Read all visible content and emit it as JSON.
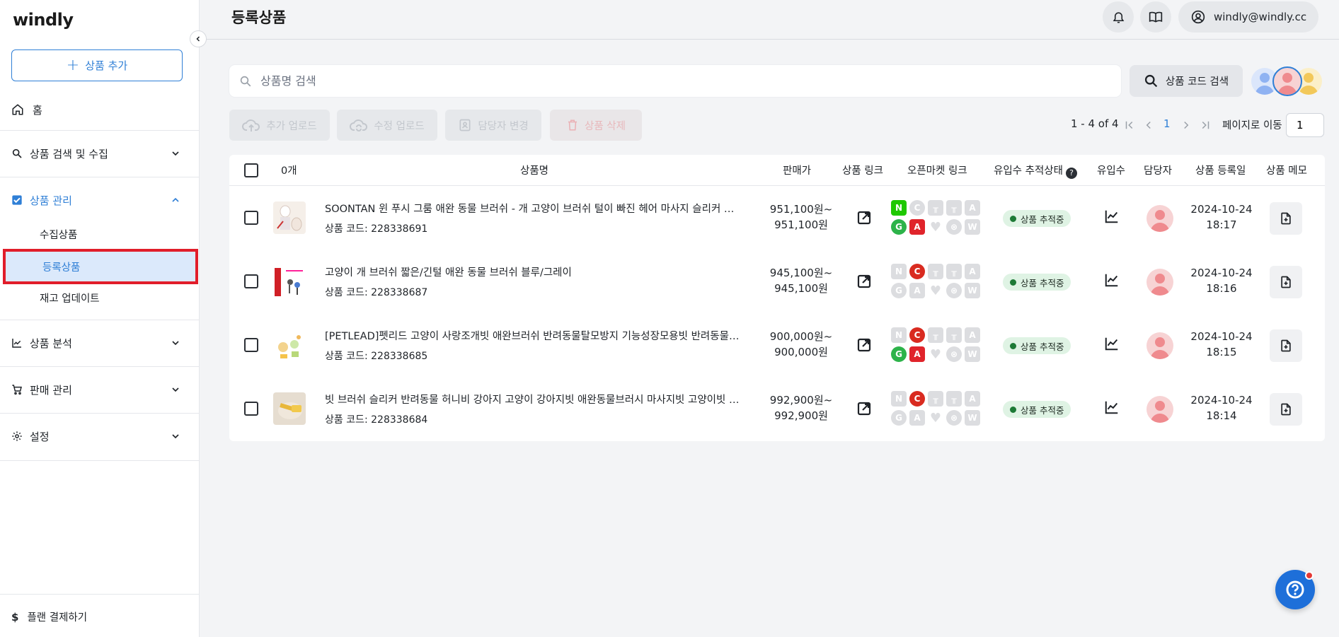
{
  "app": {
    "logo": "windly"
  },
  "sidebar": {
    "add_product_label": "상품 추가",
    "home_label": "홈",
    "groups": [
      {
        "label": "상품 검색 및 수집",
        "icon": "search-icon"
      },
      {
        "label": "상품 관리",
        "icon": "checkbox-icon",
        "expanded": true
      },
      {
        "label": "상품 분석",
        "icon": "chart-icon"
      },
      {
        "label": "판매 관리",
        "icon": "cart-icon"
      },
      {
        "label": "설정",
        "icon": "gear-icon"
      }
    ],
    "sub_items": [
      {
        "label": "수집상품"
      },
      {
        "label": "등록상품",
        "selected": true
      },
      {
        "label": "재고 업데이트"
      }
    ],
    "plan_label": "플랜 결제하기",
    "selection_highlight_color": "#e11d2a"
  },
  "header": {
    "title": "등록상품",
    "account_email": "windly@windly.cc"
  },
  "search": {
    "placeholder": "상품명 검색",
    "value": "",
    "code_search_label": "상품 코드 검색"
  },
  "actions": {
    "add_upload": "추가 업로드",
    "edit_upload": "수정 업로드",
    "change_manager": "담당자 변경",
    "delete_product": "상품 삭제"
  },
  "pagination": {
    "range_text": "1 - 4 of 4",
    "current_page": "1",
    "goto_label": "페이지로 이동",
    "goto_value": "1"
  },
  "table": {
    "headers": {
      "count": "0개",
      "name": "상품명",
      "price": "판매가",
      "link": "상품 링크",
      "market_link": "오픈마켓 링크",
      "tracking": "유입수 추적상태",
      "traffic": "유입수",
      "manager": "담당자",
      "reg_date": "상품 등록일",
      "memo": "상품 메모"
    },
    "rows": [
      {
        "name": "SOONTAN 윈 푸시 그룸 애완 동물 브러쉬 - 개 고양이 브러쉬 털이 빠진 헤어 마사지 슬리커 브러쉬",
        "code": "상품 코드: 228338691",
        "price_line1": "951,100원~",
        "price_line2": "951,100원",
        "tracking": "상품 추적중",
        "date": "2024-10-24",
        "time": "18:17",
        "markets": {
          "N": true,
          "C": false,
          "G": true,
          "A": true
        }
      },
      {
        "name": "고양이 개 브러쉬 짧은/긴털 애완 동물 브러쉬 블루/그레이",
        "code": "상품 코드: 228338687",
        "price_line1": "945,100원~",
        "price_line2": "945,100원",
        "tracking": "상품 추적중",
        "date": "2024-10-24",
        "time": "18:16",
        "markets": {
          "N": false,
          "C": true,
          "G": false,
          "A": false
        }
      },
      {
        "name": "[PETLEAD]펫리드 고양이 사랑조개빗 애완브러쉬 반려동물탈모방지 기능성장모용빗 반려동물용품",
        "code": "상품 코드: 228338685",
        "price_line1": "900,000원~",
        "price_line2": "900,000원",
        "tracking": "상품 추적중",
        "date": "2024-10-24",
        "time": "18:15",
        "markets": {
          "N": false,
          "C": true,
          "G": true,
          "A": true
        }
      },
      {
        "name": "빗 브러쉬 슬리커 반려동물 허니비 강아지 고양이 강아지빗 애완동물브러시 마사지빗 고양이빗 브러쉬",
        "code": "상품 코드: 228338684",
        "price_line1": "992,900원~",
        "price_line2": "992,900원",
        "tracking": "상품 추적중",
        "date": "2024-10-24",
        "time": "18:14",
        "markets": {
          "N": false,
          "C": true,
          "G": false,
          "A": false
        }
      }
    ]
  },
  "colors": {
    "accent": "#2f7fd6",
    "naver": "#1ec800",
    "coupang": "#d92b20",
    "gmarket": "#2db34a",
    "auction": "#e0242b",
    "tracking_dot": "#1d7a36",
    "fab": "#1e6fd9"
  }
}
